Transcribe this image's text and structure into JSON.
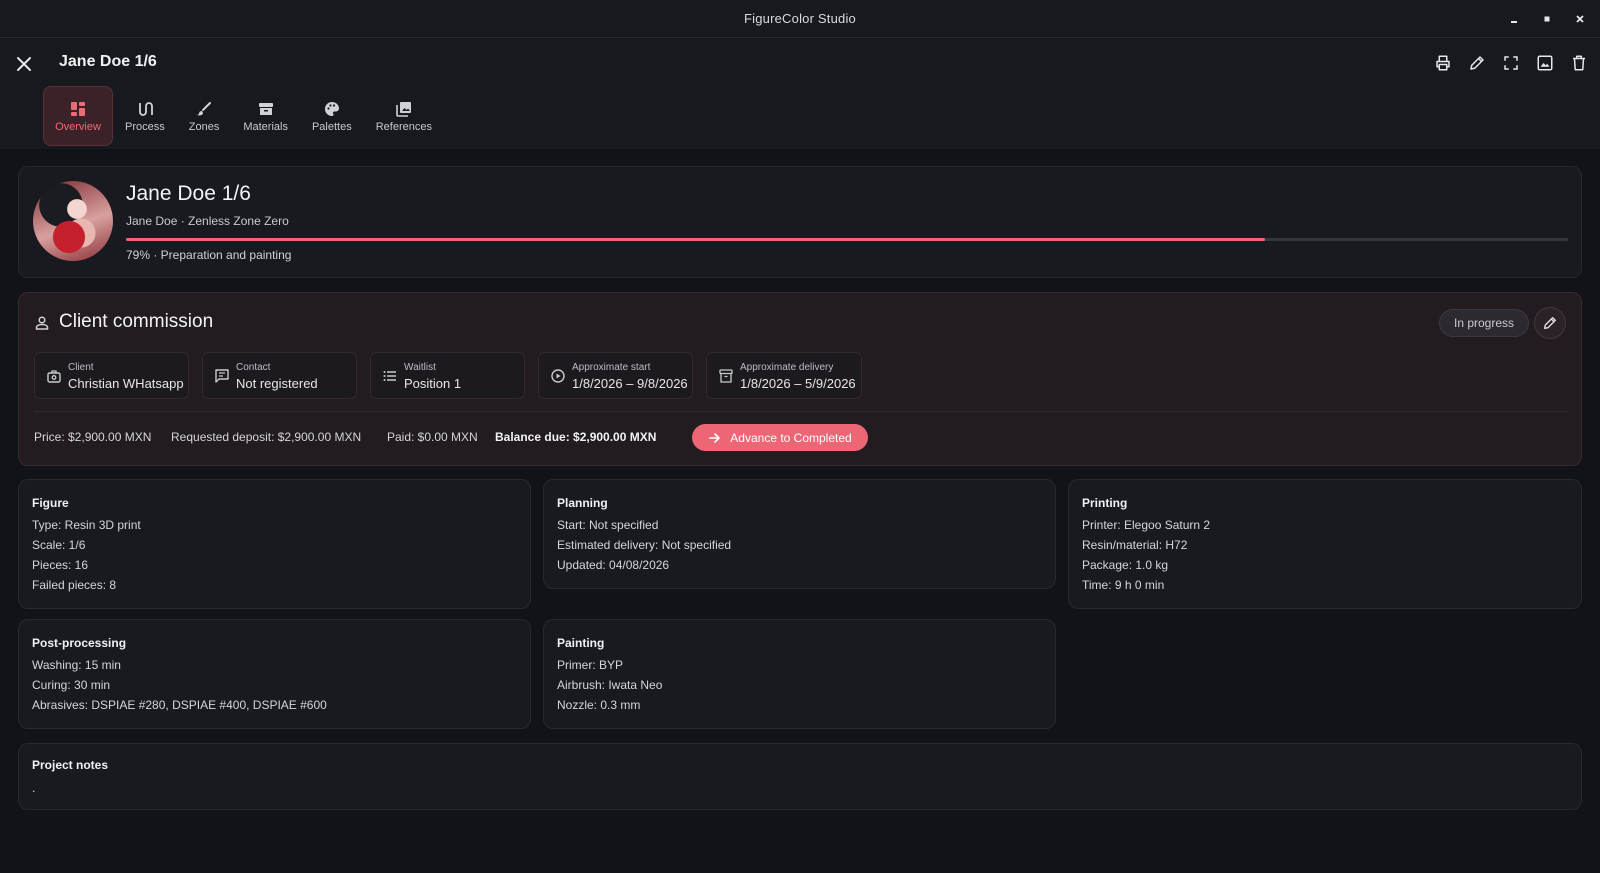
{
  "window": {
    "title": "FigureColor Studio"
  },
  "header": {
    "title": "Jane Doe 1/6"
  },
  "tabs": [
    {
      "label": "Overview",
      "icon": "dashboard-icon"
    },
    {
      "label": "Process",
      "icon": "route-icon"
    },
    {
      "label": "Zones",
      "icon": "brush-icon"
    },
    {
      "label": "Materials",
      "icon": "archive-icon"
    },
    {
      "label": "Palettes",
      "icon": "palette-icon"
    },
    {
      "label": "References",
      "icon": "image-library-icon"
    }
  ],
  "hero": {
    "title": "Jane Doe 1/6",
    "subtitle": "Jane Doe · Zenless Zone Zero",
    "progress": 0.79,
    "status": "79% · Preparation and painting"
  },
  "commission": {
    "title": "Client commission",
    "status": "In progress",
    "fields": [
      {
        "label": "Client",
        "value": "Christian WHatsapp",
        "icon": "client-icon"
      },
      {
        "label": "Contact",
        "value": "Not registered",
        "icon": "chat-icon"
      },
      {
        "label": "Waitlist",
        "value": "Position 1",
        "icon": "list-icon"
      },
      {
        "label": "Approximate start",
        "value": "1/8/2026 – 9/8/2026",
        "icon": "play-icon"
      },
      {
        "label": "Approximate delivery",
        "value": "1/8/2026 – 5/9/2026",
        "icon": "box-icon"
      }
    ],
    "price": "Price: $2,900.00 MXN",
    "deposit": "Requested deposit: $2,900.00 MXN",
    "paid": "Paid: $0.00 MXN",
    "balance": "Balance due: $2,900.00 MXN",
    "advance_label": "Advance to Completed"
  },
  "figure": {
    "title": "Figure",
    "lines": [
      "Type: Resin 3D print",
      "Scale: 1/6",
      "Pieces: 16",
      "Failed pieces: 8"
    ]
  },
  "planning": {
    "title": "Planning",
    "lines": [
      "Start: Not specified",
      "Estimated delivery: Not specified",
      "Updated: 04/08/2026"
    ]
  },
  "printing": {
    "title": "Printing",
    "lines": [
      "Printer: Elegoo Saturn 2",
      "Resin/material: H72",
      "Package: 1.0 kg",
      "Time: 9 h 0 min"
    ]
  },
  "postprocessing": {
    "title": "Post-processing",
    "lines": [
      "Washing: 15 min",
      "Curing: 30 min",
      "Abrasives: DSPIAE #280, DSPIAE #400, DSPIAE #600"
    ]
  },
  "painting": {
    "title": "Painting",
    "lines": [
      "Primer: BYP",
      "Airbrush: Iwata Neo",
      "Nozzle: 0.3 mm"
    ]
  },
  "notes": {
    "title": "Project notes",
    "body": "."
  },
  "colors": {
    "accent": "#ec6675",
    "background": "#111318",
    "card": "#181a20",
    "commission_bg": "#221b1f"
  }
}
